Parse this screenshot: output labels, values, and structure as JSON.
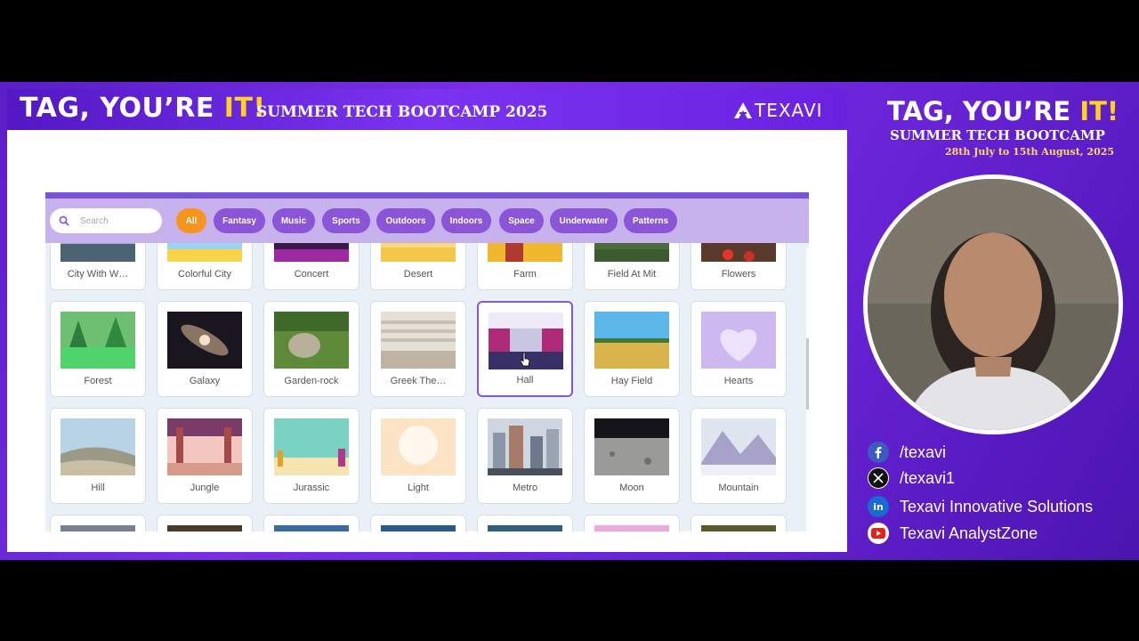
{
  "banner": {
    "title_prefix": "TAG, YOU’RE ",
    "title_it": "IT",
    "title_suffix": "!",
    "subtitle": "SUMMER TECH BOOTCAMP 2025",
    "logo_text": "TEXAVI"
  },
  "search": {
    "placeholder": "Search"
  },
  "categories": [
    "All",
    "Fantasy",
    "Music",
    "Sports",
    "Outdoors",
    "Indoors",
    "Space",
    "Underwater",
    "Patterns"
  ],
  "active_category": "All",
  "backdrops_row1": [
    "City With W…",
    "Colorful City",
    "Concert",
    "Desert",
    "Farm",
    "Field At Mit",
    "Flowers"
  ],
  "backdrops_row2": [
    "Forest",
    "Galaxy",
    "Garden-rock",
    "Greek The…",
    "Hall",
    "Hay Field",
    "Hearts"
  ],
  "backdrops_row3": [
    "Hill",
    "Jungle",
    "Jurassic",
    "Light",
    "Metro",
    "Moon",
    "Mountain"
  ],
  "selected_backdrop": "Hall",
  "right_panel": {
    "title_prefix": "TAG, YOU’RE ",
    "title_it": "IT",
    "title_suffix": "!",
    "subtitle": "SUMMER TECH BOOTCAMP",
    "dates": "28th July to 15th August, 2025",
    "socials": [
      {
        "icon": "facebook-icon",
        "text": "/texavi"
      },
      {
        "icon": "x-icon",
        "text": "/texavi1"
      },
      {
        "icon": "linkedin-icon",
        "text": "Texavi Innovative Solutions"
      },
      {
        "icon": "youtube-icon",
        "text": "Texavi AnalystZone"
      }
    ]
  },
  "colors": {
    "frame": "#6a24d8",
    "accent_yellow": "#ffd21f",
    "chip": "#8a55d6",
    "chip_active": "#f7941d",
    "toolbar": "#c7b2ee"
  }
}
